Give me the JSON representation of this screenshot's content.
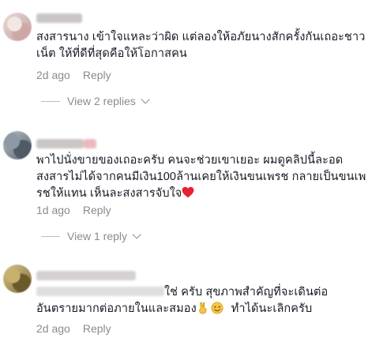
{
  "comments": [
    {
      "lines": [
        "สงสารนาง เข้าใจแหละว่าผิด แต่ลองให้อภัยนางสักครั้งกันเถอะชาว",
        "เน็ต ให้ที่ดีที่สุดคือให้โอกาสคน"
      ],
      "time": "2d ago",
      "reply_label": "Reply",
      "view_replies": "View 2 replies"
    },
    {
      "lines": [
        "พาไปนั่งขายของเถอะครับ คนจะช่วยเขาเยอะ ผมดูคลิปนี้ละอด",
        "สงสารไม่ได้จากคนมีเงิน100ล้านเคยให้เงินขนเพรช กลายเป็นขนเพ",
        "รชให้แทน เห็นละสงสารจับใจ"
      ],
      "time": "1d ago",
      "reply_label": "Reply",
      "view_replies": "View 1 reply"
    },
    {
      "lines": [
        "ใช่ ครับ สุขภาพสำคัญที่จะเดินต่อ",
        "อันตรายมากต่อภายในและสมอง",
        "ทำได้นะเลิกครับ"
      ],
      "time": "2d ago",
      "reply_label": "Reply"
    }
  ],
  "icons": {
    "heart": "heart-icon",
    "victory_hand": "victory-hand-icon",
    "smiling_face": "smiling-face-icon"
  },
  "colors": {
    "text": "#161823",
    "meta": "#8a8b91",
    "heart": "#e8202f"
  }
}
